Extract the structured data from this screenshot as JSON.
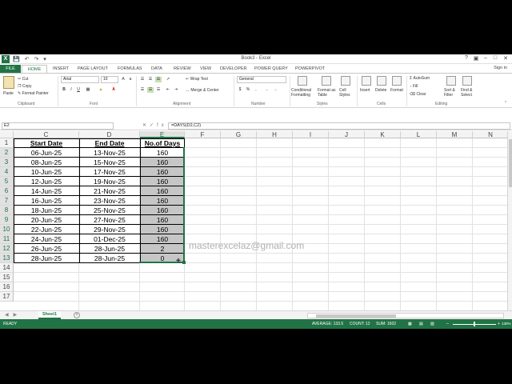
{
  "window": {
    "title": "Book3 - Excel",
    "signin": "Sign in"
  },
  "tabs": [
    "FILE",
    "HOME",
    "INSERT",
    "PAGE LAYOUT",
    "FORMULAS",
    "DATA",
    "REVIEW",
    "VIEW",
    "DEVELOPER",
    "POWER QUERY",
    "POWERPIVOT"
  ],
  "ribbon": {
    "paste": "Paste",
    "cut": "Cut",
    "copy": "Copy",
    "format_painter": "Format Painter",
    "clipboard": "Clipboard",
    "font_name": "Arial",
    "font_size": "10",
    "font": "Font",
    "wrap_text": "Wrap Text",
    "merge_center": "Merge & Center",
    "alignment": "Alignment",
    "number_format": "General",
    "number": "Number",
    "conditional_formatting": "Conditional Formatting",
    "format_as_table": "Format as Table",
    "cell_styles": "Cell Styles",
    "styles": "Styles",
    "insert": "Insert",
    "delete": "Delete",
    "format": "Format",
    "cells": "Cells",
    "autosum": "AutoSum",
    "fill": "Fill",
    "clear": "Clear",
    "sort_filter": "Sort & Filter",
    "find_select": "Find & Select",
    "editing": "Editing"
  },
  "formula_bar": {
    "name_box": "E2",
    "formula": "=DAYS(D2,C2)"
  },
  "grid": {
    "columns": [
      "C",
      "D",
      "E",
      "F",
      "G",
      "H",
      "I",
      "J",
      "K",
      "L",
      "M",
      "N"
    ],
    "rows": [
      "1",
      "2",
      "3",
      "4",
      "5",
      "6",
      "7",
      "8",
      "9",
      "10",
      "11",
      "12",
      "13",
      "14",
      "15",
      "16",
      "17"
    ],
    "headers": [
      "Start Date",
      "End Date",
      "No.of Days"
    ],
    "data": [
      [
        "06-Jun-25",
        "13-Nov-25",
        "160"
      ],
      [
        "08-Jun-25",
        "15-Nov-25",
        "160"
      ],
      [
        "10-Jun-25",
        "17-Nov-25",
        "160"
      ],
      [
        "12-Jun-25",
        "19-Nov-25",
        "160"
      ],
      [
        "14-Jun-25",
        "21-Nov-25",
        "160"
      ],
      [
        "16-Jun-25",
        "23-Nov-25",
        "160"
      ],
      [
        "18-Jun-25",
        "25-Nov-25",
        "160"
      ],
      [
        "20-Jun-25",
        "27-Nov-25",
        "160"
      ],
      [
        "22-Jun-25",
        "29-Nov-25",
        "160"
      ],
      [
        "24-Jun-25",
        "01-Dec-25",
        "160"
      ],
      [
        "26-Jun-25",
        "28-Jun-25",
        "2"
      ],
      [
        "28-Jun-25",
        "28-Jun-25",
        "0"
      ]
    ]
  },
  "watermark": "masterexcelaz@gmail.com",
  "sheet_tab": "Sheet1",
  "status": {
    "ready": "READY",
    "average": "AVERAGE: 133.5",
    "count": "COUNT: 12",
    "sum": "SUM: 1602",
    "zoom": "130%"
  }
}
